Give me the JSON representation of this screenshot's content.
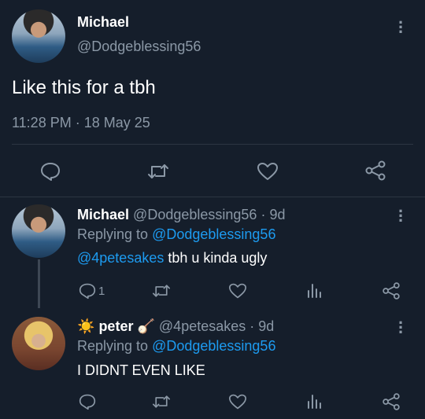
{
  "main_tweet": {
    "name": "Michael",
    "handle": "@Dodgeblessing56",
    "text": "Like this for a tbh",
    "timestamp": "11:28 PM · 18 May 25"
  },
  "replies": [
    {
      "name": "Michael",
      "handle": "@Dodgeblessing56",
      "age": "· 9d",
      "replying_prefix": "Replying to",
      "replying_to": "@Dodgeblessing56",
      "mention": "@4petesakes",
      "text": " tbh u kinda ugly",
      "reply_count": "1"
    },
    {
      "name_prefix_emoji": "☀️",
      "name": "peter",
      "name_suffix_emoji": "🪕",
      "handle": "@4petesakes",
      "age": "· 9d",
      "replying_prefix": "Replying to",
      "replying_to": "@Dodgeblessing56",
      "text": "I DIDNT EVEN LIKE"
    }
  ],
  "colors": {
    "background": "#151e2b",
    "muted": "#8b98a6",
    "link": "#1d9bf0"
  },
  "icons": [
    "reply-icon",
    "retweet-icon",
    "like-icon",
    "share-icon",
    "analytics-icon",
    "more-icon"
  ]
}
